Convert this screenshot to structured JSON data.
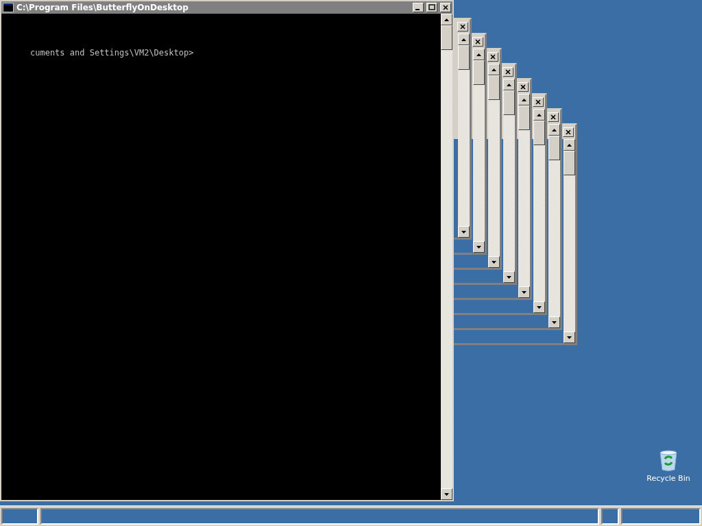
{
  "console": {
    "title": "C:\\Program Files\\ButterflyOnDesktop",
    "lines": [
      "cuments and Settings\\VM2\\Desktop>"
    ]
  },
  "desktop_icons": [
    {
      "label": "Recycle Bin"
    }
  ]
}
